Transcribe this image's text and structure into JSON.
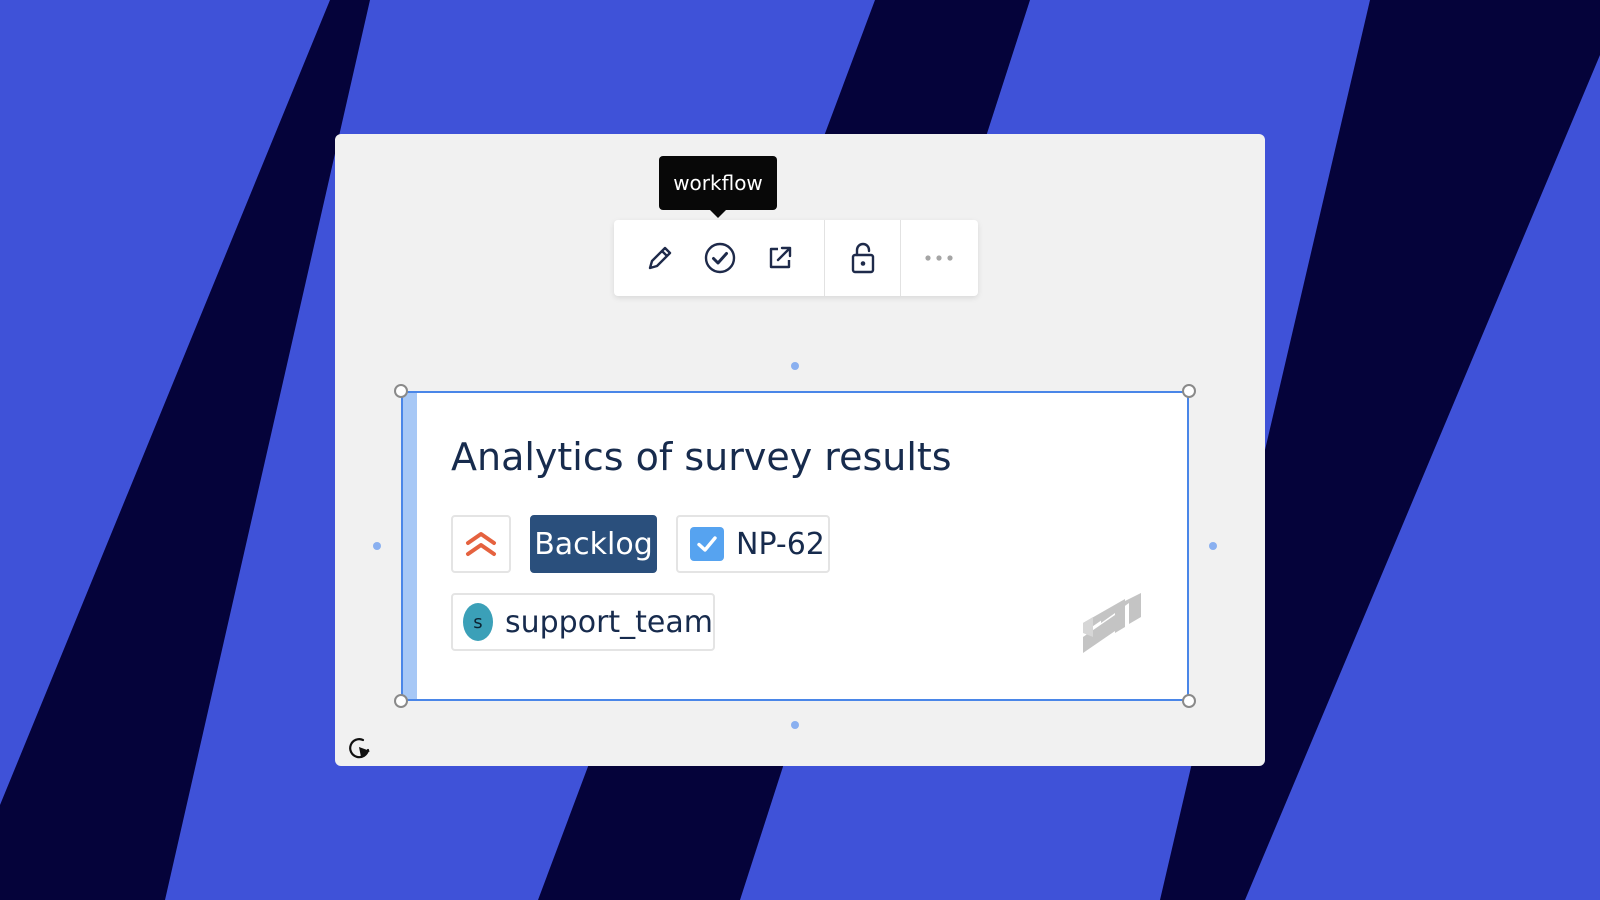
{
  "colors": {
    "background": "#3f52d8",
    "stripes": "#05033a",
    "canvas": "#f1f1f1",
    "selection": "#4a86e8",
    "status_chip": "#2a4f7c",
    "priority": "#e5623f"
  },
  "tooltip": {
    "text": "workflow"
  },
  "toolbar": {
    "buttons": [
      {
        "icon": "pencil-icon",
        "action": "edit"
      },
      {
        "icon": "check-circle-icon",
        "action": "workflow"
      },
      {
        "icon": "open-external-icon",
        "action": "open"
      },
      {
        "icon": "unlock-icon",
        "action": "lock"
      },
      {
        "icon": "more-horizontal-icon",
        "action": "more"
      }
    ]
  },
  "card": {
    "title": "Analytics of survey results",
    "priority": {
      "icon": "priority-highest-icon"
    },
    "status": "Backlog",
    "issue_key": "NP-62",
    "assignee": {
      "initial": "s",
      "name": "support_team"
    },
    "logo": "jira-logo"
  }
}
